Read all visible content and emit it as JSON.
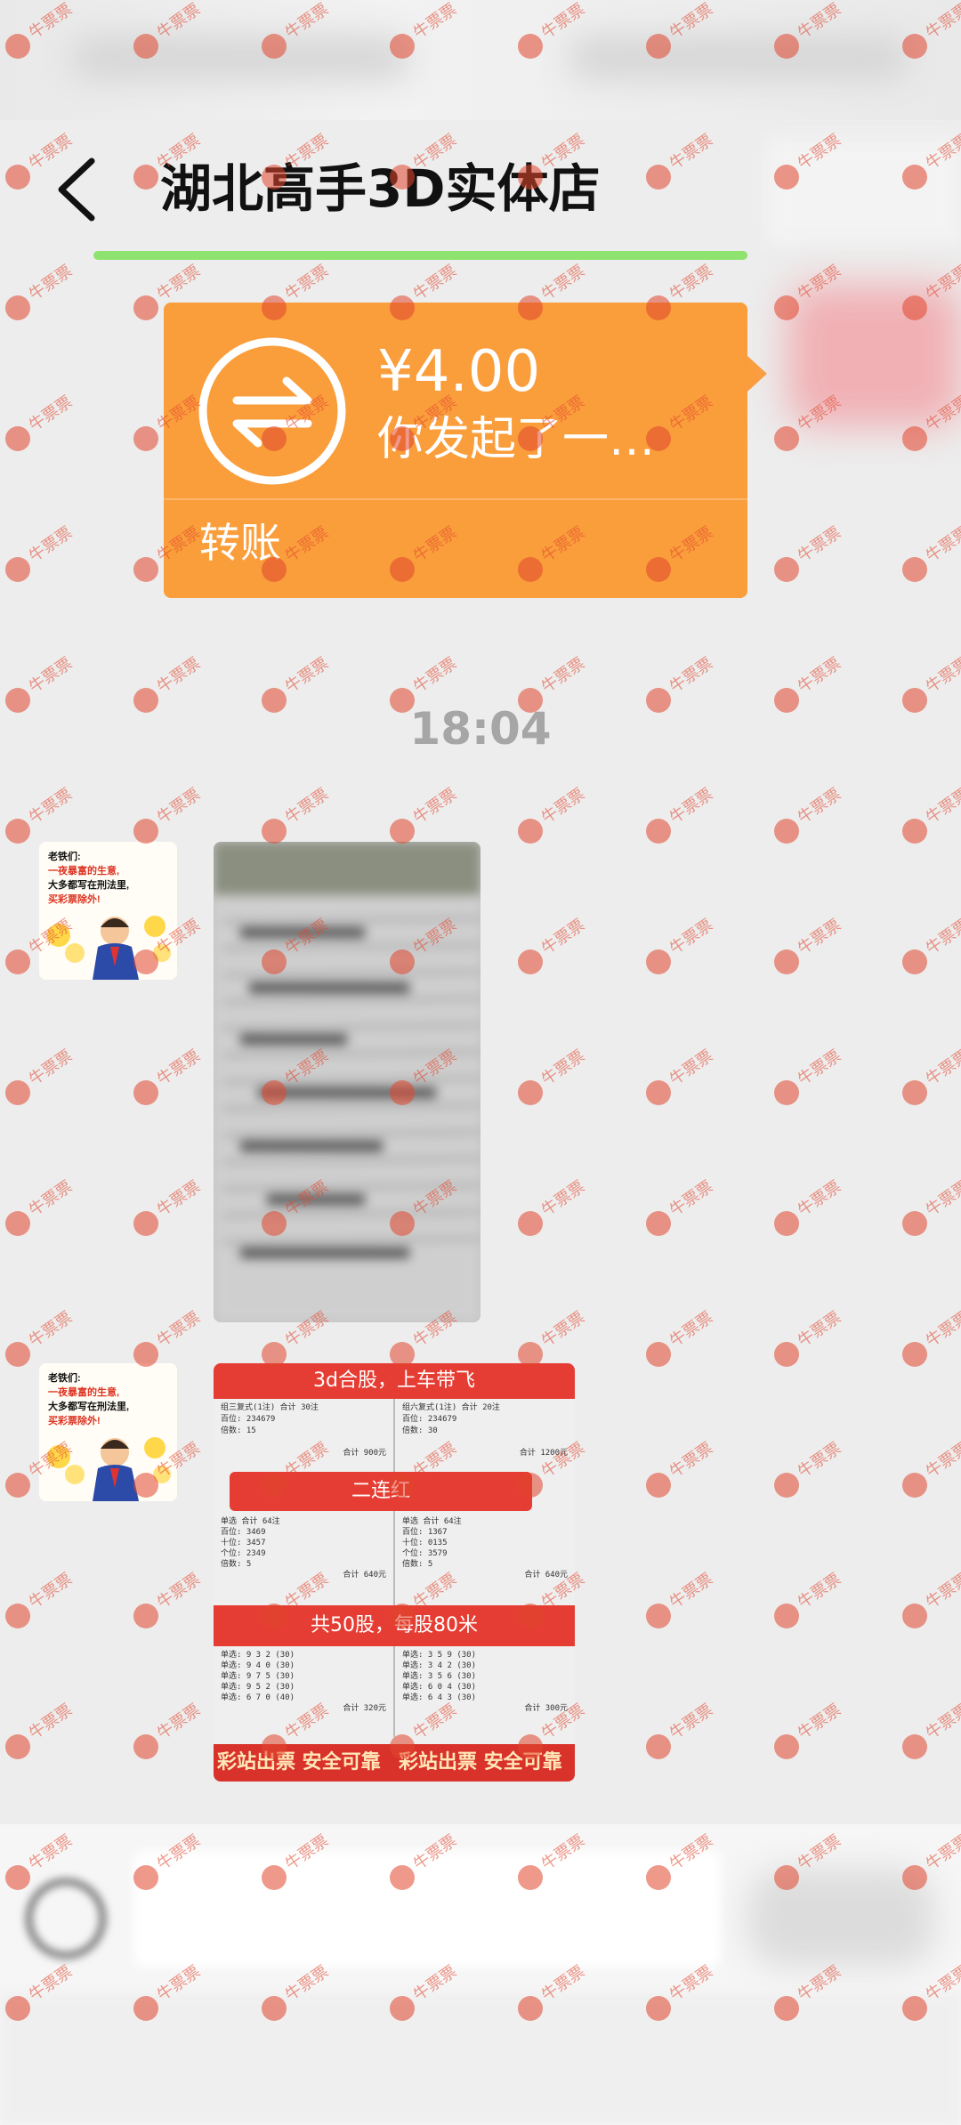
{
  "header": {
    "title": "湖北高手3D实体店"
  },
  "transfer": {
    "amount": "¥4.00",
    "description": "你发起了一…",
    "label": "转账"
  },
  "chat": {
    "timestamp": "18:04"
  },
  "avatar": {
    "line1": "老铁们:",
    "line2": "一夜暴富的生意,",
    "line3": "大多都写在刑法里,",
    "line4": "买彩票除外!"
  },
  "lottery_image": {
    "banner_top": "3d合股，上车带飞",
    "pill": "二连红",
    "banner_mid": "共50股，每股80米",
    "footer_left": "彩站出票 安全可靠",
    "footer_right": "彩站出票 安全可靠",
    "left_ticket_top": [
      "组三复式(1注) 合计 30注",
      "百位: 234679",
      "倍数: 15",
      "合计 900元"
    ],
    "right_ticket_top": [
      "组六复式(1注) 合计 20注",
      "百位: 234679",
      "倍数: 30",
      "合计 1200元"
    ],
    "left_ticket_mid": [
      "单选 合计 64注",
      "百位: 3469",
      "十位: 3457",
      "个位: 2349",
      "倍数: 5",
      "合计 640元"
    ],
    "right_ticket_mid": [
      "单选 合计 64注",
      "百位: 1367",
      "十位: 0135",
      "个位: 3579",
      "倍数: 5",
      "合计 640元"
    ],
    "left_ticket_bottom": [
      "单选: 9 3 2 (30)",
      "单选: 9 4 0 (30)",
      "单选: 9 7 5 (30)",
      "单选: 9 5 2 (30)",
      "单选: 6 7 0 (40)",
      "合计 320元"
    ],
    "right_ticket_bottom": [
      "单选: 3 5 9 (30)",
      "单选: 3 4 2 (30)",
      "单选: 3 5 6 (30)",
      "单选: 6 0 4 (30)",
      "单选: 6 4 3 (30)",
      "合计 300元"
    ]
  },
  "watermark": {
    "text": "牛票票"
  },
  "colors": {
    "transfer_bg": "#fa9d3b",
    "progress": "#8de36e",
    "lottery_red": "#e53d33",
    "watermark": "#e2462e"
  }
}
